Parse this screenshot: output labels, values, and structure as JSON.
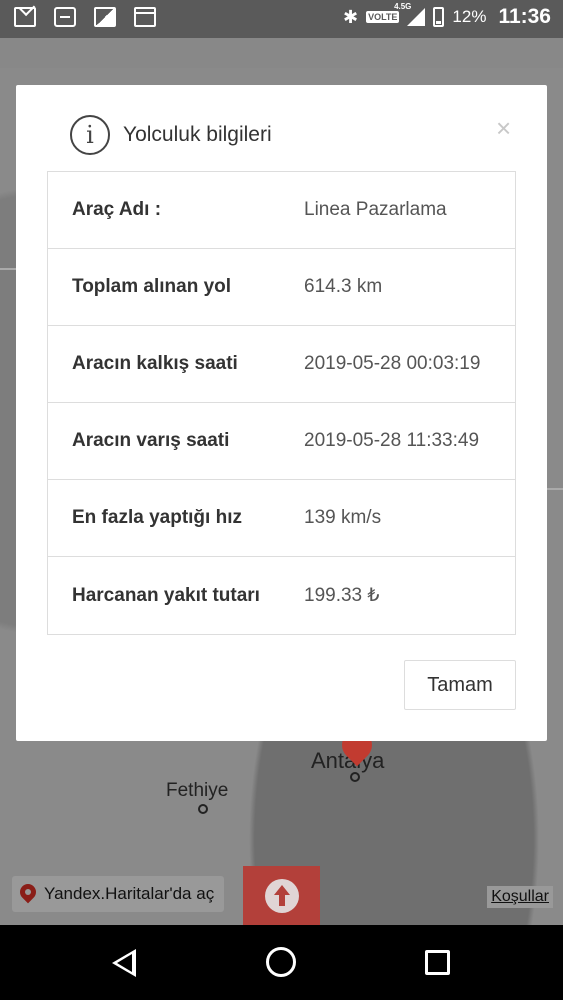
{
  "status_bar": {
    "battery": "12%",
    "time": "11:36",
    "network": "VOLTE",
    "network_gen": "4.5G"
  },
  "map": {
    "cities": [
      "Fethiye",
      "Antalya"
    ],
    "yandex_button": "Yandex.Haritalar'da aç",
    "terms_link": "Koşullar"
  },
  "dialog": {
    "title": "Yolculuk bilgileri",
    "close": "×",
    "rows": [
      {
        "label": "Araç Adı :",
        "value": "Linea Pazarlama"
      },
      {
        "label": "Toplam alınan yol",
        "value": "614.3 km"
      },
      {
        "label": "Aracın kalkış saati",
        "value": "2019-05-28 00:03:19"
      },
      {
        "label": "Aracın varış saati",
        "value": "2019-05-28 11:33:49"
      },
      {
        "label": "En fazla yaptığı hız",
        "value": "139 km/s"
      },
      {
        "label": "Harcanan yakıt tutarı",
        "value": "199.33 ₺"
      }
    ],
    "ok_button": "Tamam"
  }
}
